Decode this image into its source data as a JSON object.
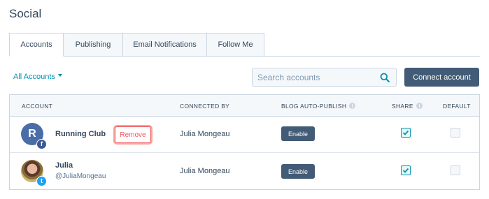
{
  "page": {
    "title": "Social"
  },
  "tabs": [
    {
      "label": "Accounts",
      "active": true
    },
    {
      "label": "Publishing",
      "active": false
    },
    {
      "label": "Email Notifications",
      "active": false
    },
    {
      "label": "Follow Me",
      "active": false
    }
  ],
  "filter": {
    "label": "All Accounts"
  },
  "search": {
    "placeholder": "Search accounts",
    "value": ""
  },
  "connect_button": {
    "label": "Connect account"
  },
  "table": {
    "headers": {
      "account": "ACCOUNT",
      "connected_by": "CONNECTED BY",
      "blog_auto_publish": "BLOG AUTO-PUBLISH",
      "share": "SHARE",
      "default": "DEFAULT"
    },
    "rows": [
      {
        "avatar_initial": "R",
        "network": "facebook",
        "network_glyph": "f",
        "name": "Running Club",
        "handle": "",
        "remove_label": "Remove",
        "connected_by": "Julia Mongeau",
        "auto_publish_label": "Enable",
        "share": true,
        "default": false
      },
      {
        "avatar_initial": "",
        "network": "twitter",
        "network_glyph": "t",
        "name": "Julia",
        "handle": "@JuliaMongeau",
        "connected_by": "Julia Mongeau",
        "auto_publish_label": "Enable",
        "share": true,
        "default": false
      }
    ]
  },
  "colors": {
    "primary_button": "#425b76",
    "link": "#0091ae",
    "remove": "#f2545b",
    "facebook": "#3b5998",
    "twitter": "#1da1f2"
  }
}
